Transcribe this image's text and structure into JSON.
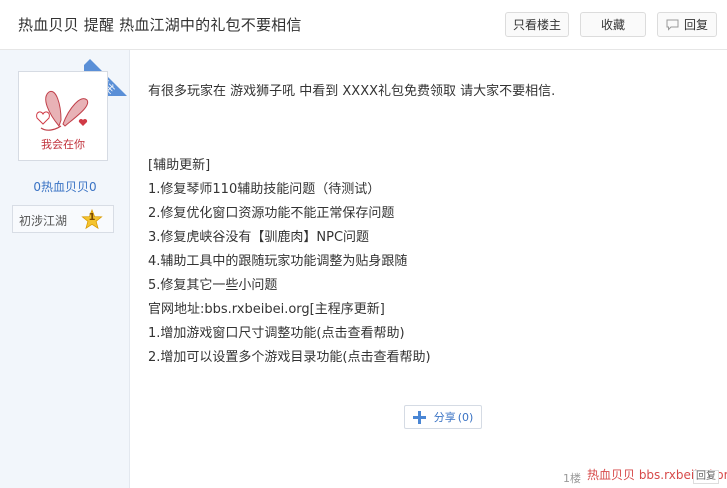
{
  "post": {
    "title": "热血贝贝 提醒 热血江湖中的礼包不要相信"
  },
  "toolbar": {
    "only_op_label": "只看楼主",
    "favorite_label": "收藏",
    "reply_label": "回复"
  },
  "author": {
    "op_tag": "楼主",
    "avatar_text": "我会在你",
    "username": "0热血贝贝0",
    "level_name": "初涉江湖",
    "level_number": "1"
  },
  "body": {
    "intro": "有很多玩家在 游戏狮子吼 中看到 XXXX礼包免费领取 请大家不要相信.",
    "lines": [
      "[辅助更新]",
      "1.修复琴师110辅助技能问题（待测试）",
      "2.修复优化窗口资源功能不能正常保存问题",
      "3.修复虎峡谷没有【驯鹿肉】NPC问题",
      "4.辅助工具中的跟随玩家功能调整为贴身跟随",
      "5.修复其它一些小问题",
      "官网地址:bbs.rxbeibei.org[主程序更新]",
      "1.增加游戏窗口尺寸调整功能(点击查看帮助)",
      "2.增加可以设置多个游戏目录功能(点击查看帮助)"
    ]
  },
  "share": {
    "label": "分享",
    "count": "(0)"
  },
  "footer": {
    "floor": "1楼",
    "watermark": "热血贝贝 bbs.rxbeibei.org",
    "reply_mini": "回复"
  },
  "colors": {
    "accent": "#3a73c4",
    "ribbon": "#5a8fd7",
    "sidebar_bg": "#f2f6fb",
    "watermark": "#d02a2a"
  },
  "icons": {
    "reply": "comment-icon",
    "share": "plus-icon",
    "level": "star-badge-icon"
  }
}
